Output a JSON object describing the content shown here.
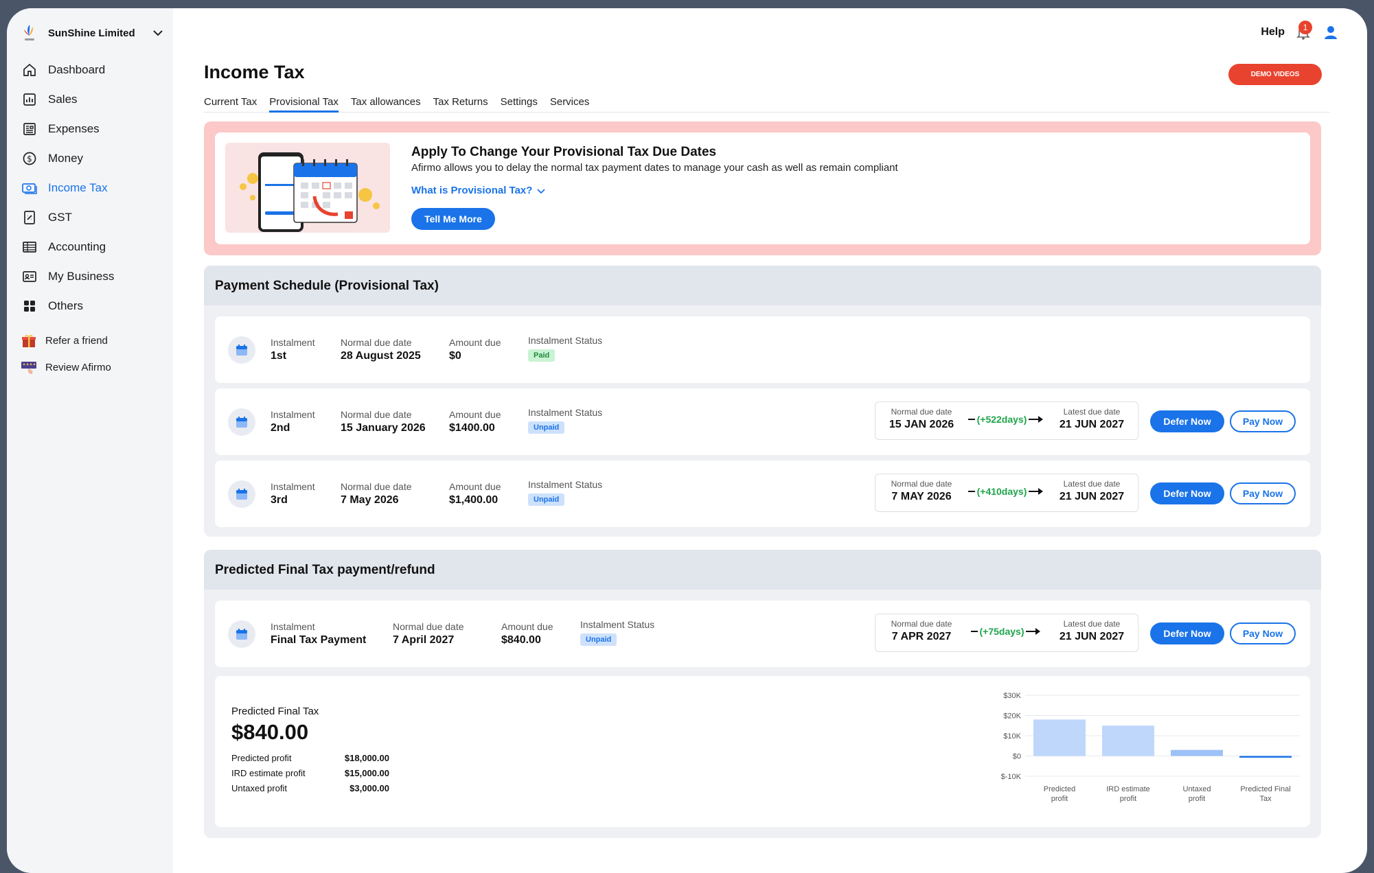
{
  "company": {
    "name": "SunShine Limited"
  },
  "nav": {
    "items": [
      {
        "label": "Dashboard",
        "icon": "home-icon"
      },
      {
        "label": "Sales",
        "icon": "sales-chart-icon"
      },
      {
        "label": "Expenses",
        "icon": "receipt-icon"
      },
      {
        "label": "Money",
        "icon": "dollar-icon"
      },
      {
        "label": "Income Tax",
        "icon": "money-icon"
      },
      {
        "label": "GST",
        "icon": "gst-icon"
      },
      {
        "label": "Accounting",
        "icon": "ledger-icon"
      },
      {
        "label": "My Business",
        "icon": "id-card-icon"
      },
      {
        "label": "Others",
        "icon": "grid-icon"
      }
    ],
    "active": "Income Tax",
    "extra": [
      {
        "label": "Refer a friend",
        "icon": "gift-icon"
      },
      {
        "label": "Review Afirmo",
        "icon": "review-icon"
      }
    ]
  },
  "header": {
    "help": "Help",
    "notification_count": "1",
    "demo_label": "DEMO VIDEOS"
  },
  "page": {
    "title": "Income Tax"
  },
  "tabs": [
    "Current Tax",
    "Provisional Tax",
    "Tax allowances",
    "Tax Returns",
    "Settings",
    "Services"
  ],
  "active_tab": "Provisional Tax",
  "promo": {
    "title": "Apply To Change Your Provisional Tax Due Dates",
    "description": "Afirmo allows you to delay the normal tax payment dates to manage your cash as well as remain compliant",
    "link": "What is Provisional Tax?",
    "button": "Tell Me More"
  },
  "schedule": {
    "title": "Payment Schedule (Provisional Tax)",
    "labels": {
      "instalment": "Instalment",
      "normal_due": "Normal due date",
      "amount_due": "Amount due",
      "status": "Instalment Status",
      "box_normal": "Normal due date",
      "box_latest": "Latest due date",
      "defer": "Defer Now",
      "pay": "Pay Now"
    },
    "rows": [
      {
        "instalment": "1st",
        "normal_due": "28 August 2025",
        "amount": "$0",
        "status": "Paid"
      },
      {
        "instalment": "2nd",
        "normal_due": "15 January 2026",
        "amount": "$1400.00",
        "status": "Unpaid",
        "box_normal": "15 JAN 2026",
        "delay": "(+522days)",
        "box_latest": "21 JUN 2027"
      },
      {
        "instalment": "3rd",
        "normal_due": "7 May 2026",
        "amount": "$1,400.00",
        "status": "Unpaid",
        "box_normal": "7 MAY 2026",
        "delay": "(+410days)",
        "box_latest": "21 JUN 2027"
      }
    ]
  },
  "final": {
    "title": "Predicted Final Tax payment/refund",
    "row": {
      "instalment": "Final Tax Payment",
      "normal_due": "7 April 2027",
      "amount": "$840.00",
      "status": "Unpaid",
      "box_normal": "7 APR 2027",
      "delay": "(+75days)",
      "box_latest": "21 JUN 2027"
    },
    "summary": {
      "label": "Predicted Final Tax",
      "value": "$840.00",
      "rows": [
        {
          "label": "Predicted profit",
          "value": "$18,000.00"
        },
        {
          "label": "IRD estimate profit",
          "value": "$15,000.00"
        },
        {
          "label": "Untaxed profit",
          "value": "$3,000.00"
        }
      ]
    }
  },
  "chart_data": {
    "type": "bar",
    "categories": [
      "Predicted profit",
      "IRD estimate profit",
      "Untaxed profit",
      "Predicted Final Tax"
    ],
    "values": [
      18000,
      15000,
      3000,
      -840
    ],
    "ylim": [
      -10000,
      30000
    ],
    "yticks": [
      -10000,
      0,
      10000,
      20000,
      30000
    ],
    "ytick_labels": [
      "$-10K",
      "$0",
      "$10K",
      "$20K",
      "$30K"
    ],
    "grid": true,
    "colors": [
      "#bfd7fb",
      "#bfd7fb",
      "#9cc2f7",
      "#1a73e8"
    ]
  },
  "colors": {
    "accent": "#1a73e8",
    "danger": "#e8432e",
    "success": "#1ea54b"
  }
}
